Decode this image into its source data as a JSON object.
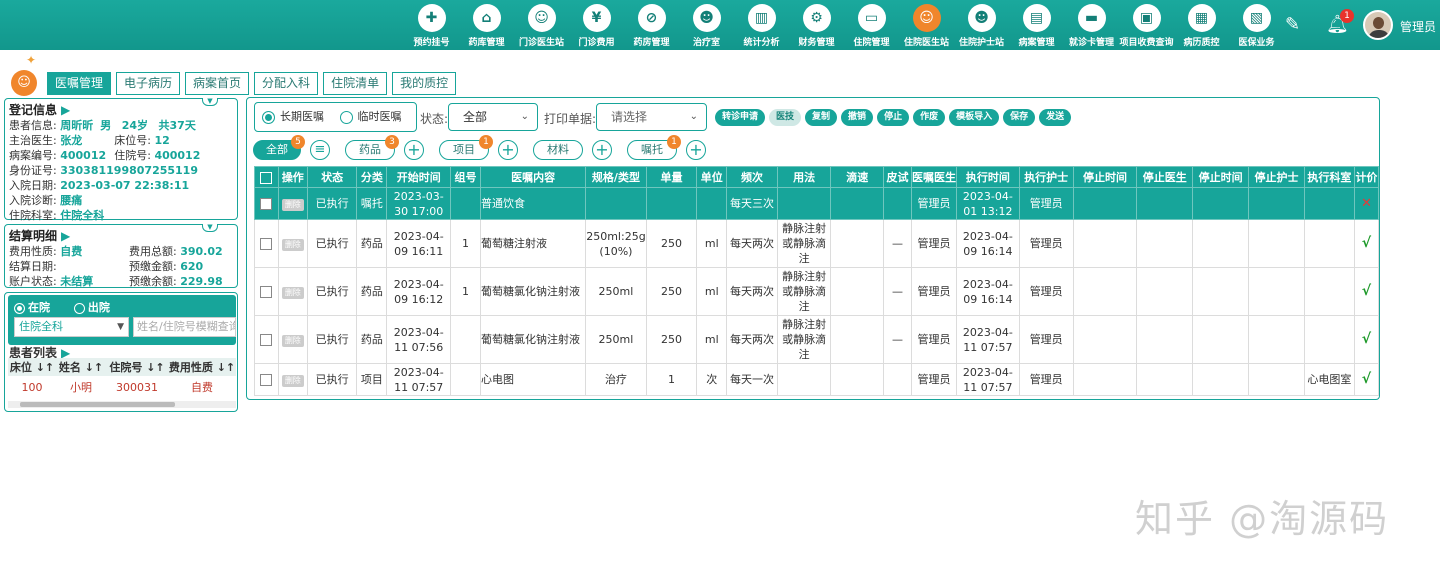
{
  "nav": [
    {
      "label": "预约挂号",
      "icon": "register-icon",
      "glyph": "✚"
    },
    {
      "label": "药库管理",
      "icon": "warehouse-icon",
      "glyph": "⌂"
    },
    {
      "label": "门诊医生站",
      "icon": "doctor-icon",
      "glyph": "☺"
    },
    {
      "label": "门诊费用",
      "icon": "yen-icon",
      "glyph": "¥"
    },
    {
      "label": "药房管理",
      "icon": "pill-icon",
      "glyph": "⊘"
    },
    {
      "label": "治疗室",
      "icon": "treatment-icon",
      "glyph": "☻"
    },
    {
      "label": "统计分析",
      "icon": "chart-icon",
      "glyph": "▥"
    },
    {
      "label": "财务管理",
      "icon": "finance-icon",
      "glyph": "⚙"
    },
    {
      "label": "住院管理",
      "icon": "bed-icon",
      "glyph": "▭"
    },
    {
      "label": "住院医生站",
      "icon": "inpatient-doctor-icon",
      "glyph": "☺",
      "active": true
    },
    {
      "label": "住院护士站",
      "icon": "nurse-icon",
      "glyph": "☻"
    },
    {
      "label": "病案管理",
      "icon": "record-icon",
      "glyph": "▤"
    },
    {
      "label": "就诊卡管理",
      "icon": "card-icon",
      "glyph": "▬"
    },
    {
      "label": "项目收费查询",
      "icon": "fee-query-icon",
      "glyph": "▣"
    },
    {
      "label": "病历质控",
      "icon": "quality-icon",
      "glyph": "▦"
    },
    {
      "label": "医保业务",
      "icon": "insurance-icon",
      "glyph": "▧"
    }
  ],
  "header": {
    "user": "管理员",
    "notifications": "1"
  },
  "tabs": [
    "医嘱管理",
    "电子病历",
    "病案首页",
    "分配入科",
    "住院清单",
    "我的质控"
  ],
  "patient_info": {
    "title": "登记信息",
    "label_patient": "患者信息:",
    "name": "周昕昕",
    "gender": "男",
    "age": "24岁",
    "days": "共37天",
    "label_doctor": "主治医生:",
    "doctor": "张龙",
    "label_bed": "床位号:",
    "bed": "12",
    "label_case": "病案编号:",
    "case_no": "400012",
    "label_admit_no": "住院号:",
    "admit_no": "400012",
    "label_id": "身份证号:",
    "id_no": "330381199807255119",
    "label_date": "入院日期:",
    "admit_date": "2023-03-07 22:38:11",
    "label_diag": "入院诊断:",
    "diagnosis": "腰痛",
    "label_dept": "住院科室:",
    "dept": "住院全科"
  },
  "billing": {
    "title": "结算明细",
    "label_fee_type": "费用性质:",
    "fee_type": "自费",
    "label_total": "费用总额:",
    "total": "390.02",
    "label_settle": "结算日期:",
    "settle_date": "",
    "label_prepay": "预缴金额:",
    "prepay": "620",
    "label_account": "账户状态:",
    "account": "未结算",
    "label_balance": "预缴余额:",
    "balance": "229.98"
  },
  "patient_list": {
    "in_label": "在院",
    "out_label": "出院",
    "ward": "住院全科",
    "search_placeholder": "姓名/住院号模糊查询",
    "title": "患者列表",
    "headers": [
      "床位 ↓↑",
      "姓名 ↓↑",
      "住院号 ↓↑",
      "费用性质 ↓↑"
    ],
    "rows": [
      [
        "100",
        "小明",
        "300031",
        "自费"
      ]
    ]
  },
  "orders": {
    "type_long": "长期医嘱",
    "type_temp": "临时医嘱",
    "status_label": "状态:",
    "status_value": "全部",
    "print_label": "打印单据:",
    "print_placeholder": "请选择",
    "actions": [
      "转诊申请",
      "医技",
      "复制",
      "撤销",
      "停止",
      "作废",
      "模板导入",
      "保存",
      "发送"
    ],
    "filters": {
      "all": "全部",
      "all_count": "5",
      "drug": "药品",
      "drug_count": "3",
      "item": "项目",
      "item_count": "1",
      "material": "材料",
      "entrust": "嘱托",
      "entrust_count": "1"
    },
    "headers": [
      "操作",
      "状态",
      "分类",
      "开始时间",
      "组号",
      "医嘱内容",
      "规格/类型",
      "单量",
      "单位",
      "频次",
      "用法",
      "滴速",
      "皮试",
      "医嘱医生",
      "执行时间",
      "执行护士",
      "停止时间",
      "停止医生",
      "停止时间",
      "停止护士",
      "执行科室",
      "计价"
    ],
    "delete_label": "删除",
    "rows": [
      {
        "status": "已执行",
        "cat": "嘱托",
        "start": "2023-03-30 17:00",
        "group": "",
        "content": "普通饮食",
        "spec": "",
        "qty": "",
        "unit": "",
        "freq": "每天三次",
        "usage": "",
        "drip": "",
        "skin": "",
        "doctor": "管理员",
        "exec_time": "2023-04-01 13:12",
        "nurse": "管理员",
        "stop_time": "",
        "stop_doc": "",
        "stop_time2": "",
        "stop_nurse": "",
        "dept": "",
        "price": "✕",
        "hl": true
      },
      {
        "status": "已执行",
        "cat": "药品",
        "start": "2023-04-09 16:11",
        "group": "1",
        "content": "葡萄糖注射液",
        "spec": "250ml:25g (10%)",
        "qty": "250",
        "unit": "ml",
        "freq": "每天两次",
        "usage": "静脉注射或静脉滴注",
        "drip": "",
        "skin": "—",
        "doctor": "管理员",
        "exec_time": "2023-04-09 16:14",
        "nurse": "管理员",
        "stop_time": "",
        "stop_doc": "",
        "stop_time2": "",
        "stop_nurse": "",
        "dept": "",
        "price": "√"
      },
      {
        "status": "已执行",
        "cat": "药品",
        "start": "2023-04-09 16:12",
        "group": "1",
        "content": "葡萄糖氯化钠注射液",
        "spec": "250ml",
        "qty": "250",
        "unit": "ml",
        "freq": "每天两次",
        "usage": "静脉注射或静脉滴注",
        "drip": "",
        "skin": "—",
        "doctor": "管理员",
        "exec_time": "2023-04-09 16:14",
        "nurse": "管理员",
        "stop_time": "",
        "stop_doc": "",
        "stop_time2": "",
        "stop_nurse": "",
        "dept": "",
        "price": "√"
      },
      {
        "status": "已执行",
        "cat": "药品",
        "start": "2023-04-11 07:56",
        "group": "",
        "content": "葡萄糖氯化钠注射液",
        "spec": "250ml",
        "qty": "250",
        "unit": "ml",
        "freq": "每天两次",
        "usage": "静脉注射或静脉滴注",
        "drip": "",
        "skin": "—",
        "doctor": "管理员",
        "exec_time": "2023-04-11 07:57",
        "nurse": "管理员",
        "stop_time": "",
        "stop_doc": "",
        "stop_time2": "",
        "stop_nurse": "",
        "dept": "",
        "price": "√"
      },
      {
        "status": "已执行",
        "cat": "项目",
        "start": "2023-04-11 07:57",
        "group": "",
        "content": "心电图",
        "spec": "治疗",
        "qty": "1",
        "unit": "次",
        "freq": "每天一次",
        "usage": "",
        "drip": "",
        "skin": "",
        "doctor": "管理员",
        "exec_time": "2023-04-11 07:57",
        "nurse": "管理员",
        "stop_time": "",
        "stop_doc": "",
        "stop_time2": "",
        "stop_nurse": "",
        "dept": "心电图室",
        "price": "√"
      }
    ]
  },
  "watermark": "知乎 @淘源码"
}
